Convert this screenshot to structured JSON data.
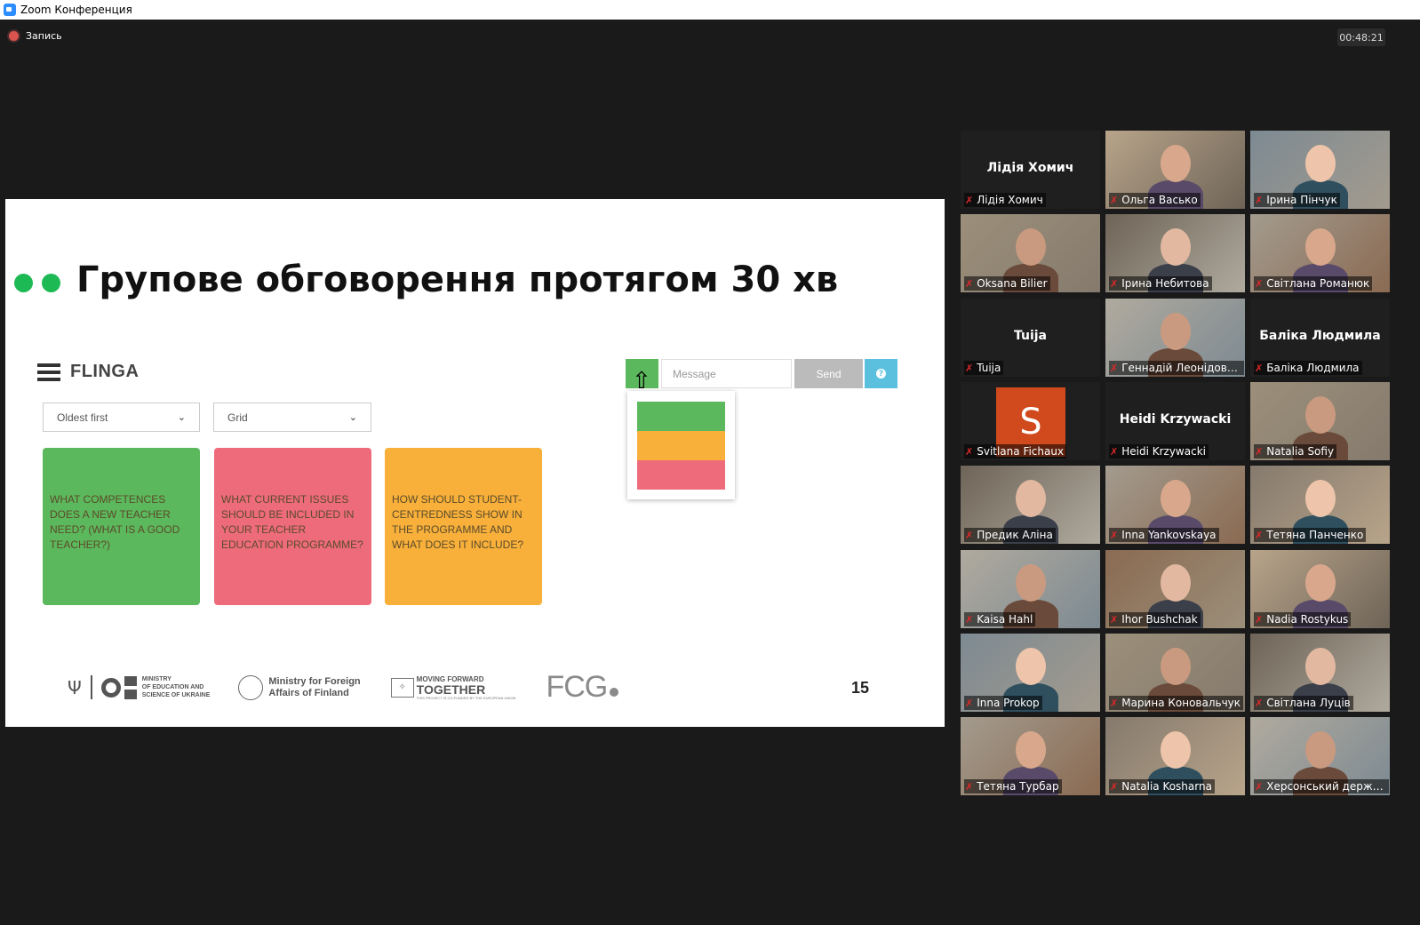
{
  "window": {
    "title": "Zoom Конференция"
  },
  "recording": {
    "label": "Запись"
  },
  "timer": "00:48:21",
  "slide": {
    "title": "Групове обговорення протягом 30 хв",
    "page_number": "15",
    "flinga": {
      "logo_text": "FLINGA",
      "sort_select": "Oldest first",
      "view_select": "Grid",
      "message_placeholder": "Message",
      "send_label": "Send",
      "help_label": "?",
      "cards": [
        {
          "text": "WHAT COMPETENCES DOES A NEW TEACHER NEED? (WHAT IS A GOOD TEACHER?)",
          "color": "#5cb85c"
        },
        {
          "text": "WHAT CURRENT ISSUES SHOULD BE INCLUDED IN YOUR TEACHER EDUCATION PROGRAMME?",
          "color": "#ee6b7c"
        },
        {
          "text": "HOW SHOULD STUDENT-CENTREDNESS SHOW IN THE PROGRAMME AND WHAT DOES IT INCLUDE?",
          "color": "#f8b03a"
        }
      ],
      "palette_colors": [
        "#5cb85c",
        "#f8b03a",
        "#ee6b7c"
      ]
    },
    "logos": {
      "moe": "MINISTRY\nOF EDUCATION AND\nSCIENCE OF UKRAINE",
      "finland": "Ministry for Foreign\nAffairs of Finland",
      "eu_top": "MOVING FORWARD",
      "eu_main": "TOGETHER",
      "eu_small": "THIS PROJECT IS CO-FUNDED BY THE EUROPEAN UNION",
      "fcg": "FCG"
    }
  },
  "participants": [
    {
      "name": "Лідія Хомич",
      "big_name": "Лідія Хомич",
      "video": false
    },
    {
      "name": "Ольга Васько",
      "video": true
    },
    {
      "name": "Ірина Пінчук",
      "video": true
    },
    {
      "name": "Oksana Bilier",
      "video": true
    },
    {
      "name": "Ірина Небитова",
      "video": true
    },
    {
      "name": "Світлана Романюк",
      "video": true
    },
    {
      "name": "Tuija",
      "big_name": "Tuija",
      "video": false
    },
    {
      "name": "Геннадій Леонідович...",
      "video": true
    },
    {
      "name": "Баліка Людмила",
      "big_name": "Баліка Людмила",
      "video": false
    },
    {
      "name": "Svitlana Fichaux",
      "avatar_letter": "S",
      "video": false
    },
    {
      "name": "Heidi Krzywacki",
      "big_name": "Heidi Krzywacki",
      "video": false
    },
    {
      "name": "Natalia Sofiy",
      "video": true
    },
    {
      "name": "Предик Аліна",
      "video": true
    },
    {
      "name": "Inna Yankovskaya",
      "video": true
    },
    {
      "name": "Тетяна Панченко",
      "video": true
    },
    {
      "name": "Kaisa Hahl",
      "video": true,
      "active_speaker": true
    },
    {
      "name": "Ihor Bushchak",
      "video": true
    },
    {
      "name": "Nadia Rostykus",
      "video": true
    },
    {
      "name": "Inna Prokop",
      "video": true
    },
    {
      "name": "Марина Коновальчук",
      "video": true
    },
    {
      "name": "Світлана Луців",
      "video": true
    },
    {
      "name": "Тетяна Турбар",
      "video": true
    },
    {
      "name": "Natalia Kosharna",
      "video": true
    },
    {
      "name": "Херсонський держав...",
      "video": true
    }
  ]
}
